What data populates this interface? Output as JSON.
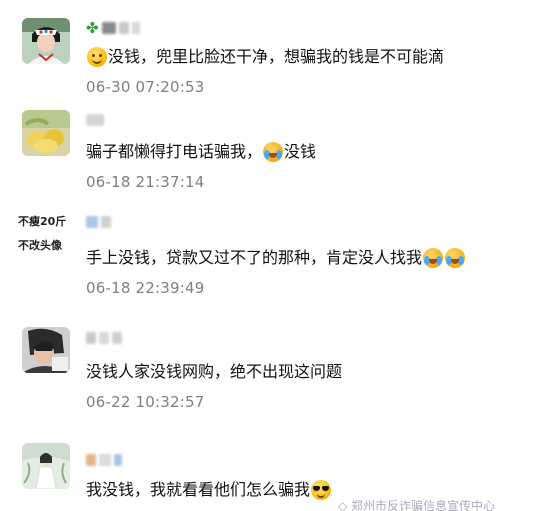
{
  "comments": [
    {
      "text": "没钱，兜里比脸还干净，想骗我的钱是不可能滴",
      "time": "06-30 07:20:53",
      "emoji_before": "smile-emoji",
      "badge_icon": "four-leaf-clover-icon"
    },
    {
      "text": "骗子都懒得打电话骗我，",
      "text_after": "没钱",
      "time": "06-18 21:37:14",
      "emoji": "crying-emoji"
    },
    {
      "avatar_text": [
        "不瘦20斤",
        "不改头像"
      ],
      "text": "手上没钱，贷款又过不了的那种，肯定没人找我",
      "time": "06-18 22:39:49",
      "emoji": "crying-emoji"
    },
    {
      "text": "没钱人家没钱网购，绝不出现这问题",
      "time": "06-22 10:32:57"
    },
    {
      "text": "我没钱，我就看看他们怎么骗我",
      "emoji": "sunglasses-emoji"
    }
  ],
  "watermark": "◇ 郑州市反诈骗信息宣传中心"
}
